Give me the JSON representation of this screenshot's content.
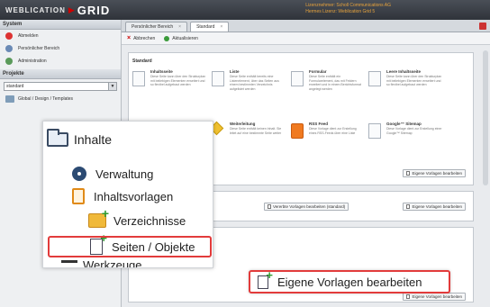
{
  "header": {
    "logo_left": "WEBLICATION",
    "logo_right": "GRID",
    "user_line1": "Lizenznehmer: Scholl Communications AG",
    "user_line2": "Hermes Lizenz: Weblication Grid 5"
  },
  "sidebar": {
    "system_head": "System",
    "system_items": [
      "Abmelden",
      "Persönlicher Bereich",
      "Administration"
    ],
    "projects_head": "Projekte",
    "project_select": "standard",
    "tree_items": [
      "Global / Design / Templates"
    ]
  },
  "tabs": [
    {
      "label": "Persönlicher Bereich"
    },
    {
      "label": "Standard"
    }
  ],
  "toolbar": {
    "close_label": "Abbrechen",
    "refresh_label": "Aktualisieren"
  },
  "main": {
    "section_title": "Standard",
    "templates": [
      {
        "title": "Inhaltsseite",
        "desc": "Diese Seite kann über den Strukturplan mit beliebigen Elementen erweitert und so flexibel aufgebaut werden"
      },
      {
        "title": "Liste",
        "desc": "Diese Seite enthält bereits eine Listenelement, über das Seiten aus einem bestimmten Verzeichnis aufgelistet werden"
      },
      {
        "title": "Formular",
        "desc": "Diese Seite enthält ein Formularelement, das mit Feldern erweitert und in einem Berichtsformat angelegt werden"
      },
      {
        "title": "Leere Inhaltsseite",
        "desc": "Diese Seite kann über den Strukturplan mit beliebigen Elementen erweitert und so flexibel aufgebaut werden"
      },
      {
        "title": "Weiterleitung",
        "desc": "Diese Seite enthält keinen Inhalt. Sie leitet auf eine bestimmte Seite weiter"
      },
      {
        "title": "RSS Feed",
        "desc": "Diese Vorlage dient zur Erstellung eines RSS-Feeds über eine Liste"
      },
      {
        "title": "Google™ Sitemap",
        "desc": "Diese Vorlage dient zur Erstellung einer Google™ Sitemap"
      }
    ],
    "edit_own_small": "Eigene Vorlagen bearbeiten",
    "edit_standard": "Vererbte Vorlagen bearbeiten (standard)",
    "edit_own_small_2": "Eigene Vorlagen bearbeiten",
    "edit_own_small_3": "Eigene Vorlagen bearbeiten"
  },
  "zoom_menu": {
    "inhalte": "Inhalte",
    "verwaltung": "Verwaltung",
    "inhaltsvorlagen": "Inhaltsvorlagen",
    "verzeichnisse": "Verzeichnisse",
    "seiten_objekte": "Seiten / Objekte",
    "werkzeuge": "Werkzeuge"
  },
  "highlight_button": {
    "label": "Eigene Vorlagen bearbeiten"
  },
  "colors": {
    "highlight_red": "#e23b3b",
    "topbar": "#3a3f46",
    "accent_orange": "#e08a17"
  }
}
